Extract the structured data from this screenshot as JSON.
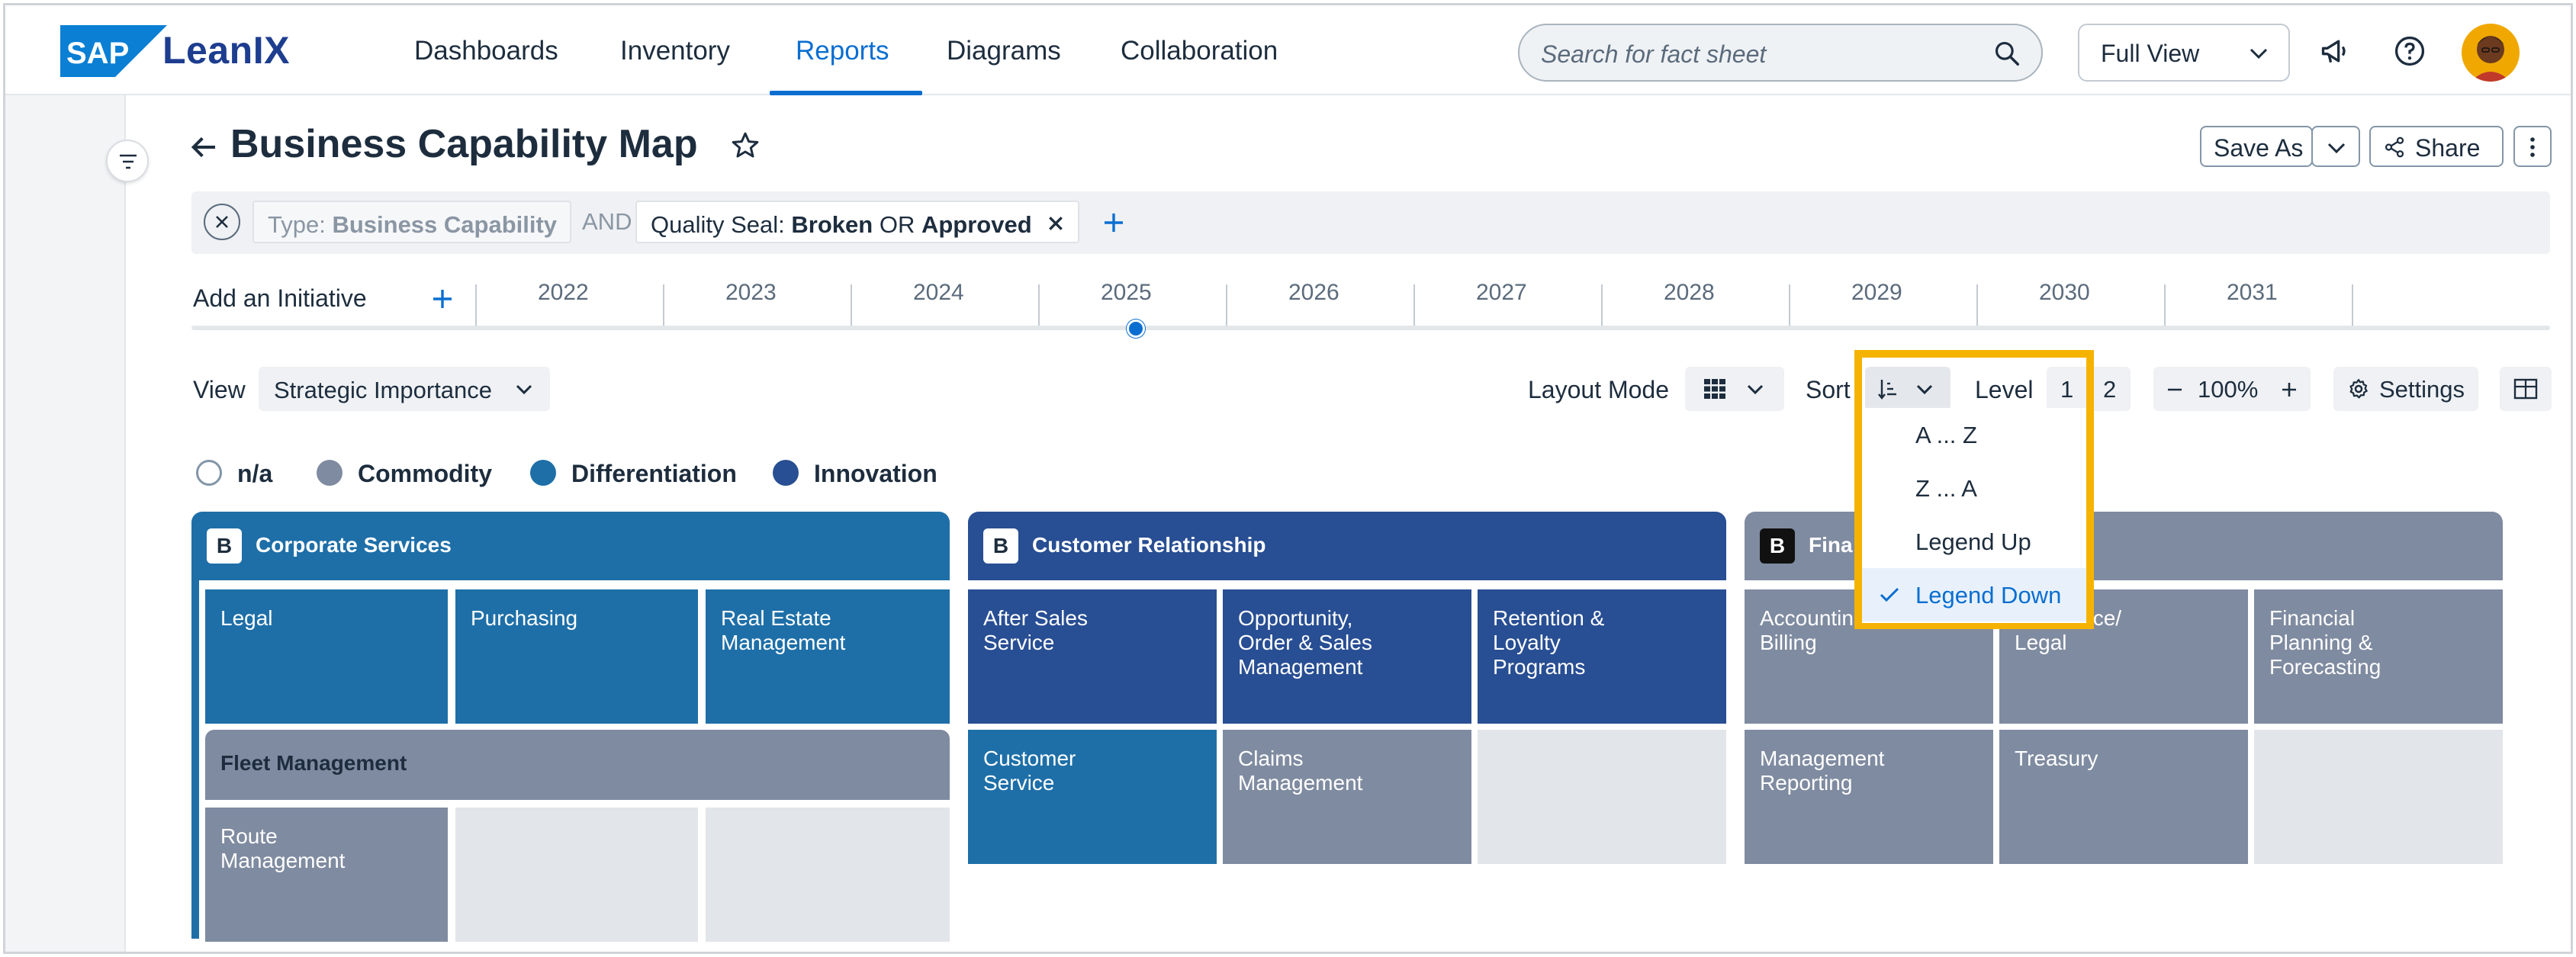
{
  "topbar": {
    "logo_sap": "SAP",
    "logo_brand": "LeanIX",
    "nav": [
      "Dashboards",
      "Inventory",
      "Reports",
      "Diagrams",
      "Collaboration"
    ],
    "active_nav": "Reports",
    "search_placeholder": "Search for fact sheet",
    "view_select": "Full View",
    "icons": [
      "megaphone-icon",
      "help-icon",
      "user-avatar"
    ]
  },
  "page": {
    "title": "Business Capability Map",
    "save_as": "Save As",
    "share": "Share"
  },
  "filters": {
    "type_label": "Type:",
    "type_value": "Business Capability",
    "and": "AND",
    "quality_label": "Quality Seal:",
    "quality_a": "Broken",
    "or": "OR",
    "quality_b": "Approved"
  },
  "timeline": {
    "add_label": "Add an Initiative",
    "years": [
      "2022",
      "2023",
      "2024",
      "2025",
      "2026",
      "2027",
      "2028",
      "2029",
      "2030",
      "2031"
    ],
    "current_year": "2025"
  },
  "toolbar": {
    "view_label": "View",
    "view_value": "Strategic Importance",
    "layout_label": "Layout Mode",
    "sort_label": "Sort",
    "level_label": "Level",
    "level_1": "1",
    "level_2": "2",
    "zoom": "100%",
    "settings": "Settings"
  },
  "legend": [
    {
      "label": "n/a",
      "color": "#ffffff"
    },
    {
      "label": "Commodity",
      "color": "#7f8ba0"
    },
    {
      "label": "Differentiation",
      "color": "#1e6fa8"
    },
    {
      "label": "Innovation",
      "color": "#284e93"
    }
  ],
  "sort_menu": {
    "items": [
      "A ... Z",
      "Z ... A",
      "Legend Up",
      "Legend Down"
    ],
    "selected": "Legend Down"
  },
  "capabilities": [
    {
      "badge": "B",
      "name": "Corporate Services",
      "tiles": [
        "Legal",
        "Purchasing",
        "Real Estate\nManagement"
      ],
      "sub_group": "Fleet Management",
      "sub_tiles": [
        "Route\nManagement"
      ]
    },
    {
      "badge": "B",
      "name": "Customer Relationship",
      "tiles": [
        "After Sales\nService",
        "Opportunity,\nOrder & Sales\nManagement",
        "Retention &\nLoyalty\nPrograms",
        "Customer\nService",
        "Claims\nManagement"
      ]
    },
    {
      "badge": "B",
      "name": "Fina",
      "tiles": [
        "Accountin\nBilling",
        "Assurance/\nLegal",
        "Financial\nPlanning &\nForecasting",
        "Management\nReporting",
        "Treasury"
      ]
    }
  ],
  "colors": {
    "commodity": "#7f8ba0",
    "differentiation": "#1e6fa8",
    "innovation": "#284e93",
    "accent": "#0a6ed1",
    "highlight": "#f5b300"
  }
}
